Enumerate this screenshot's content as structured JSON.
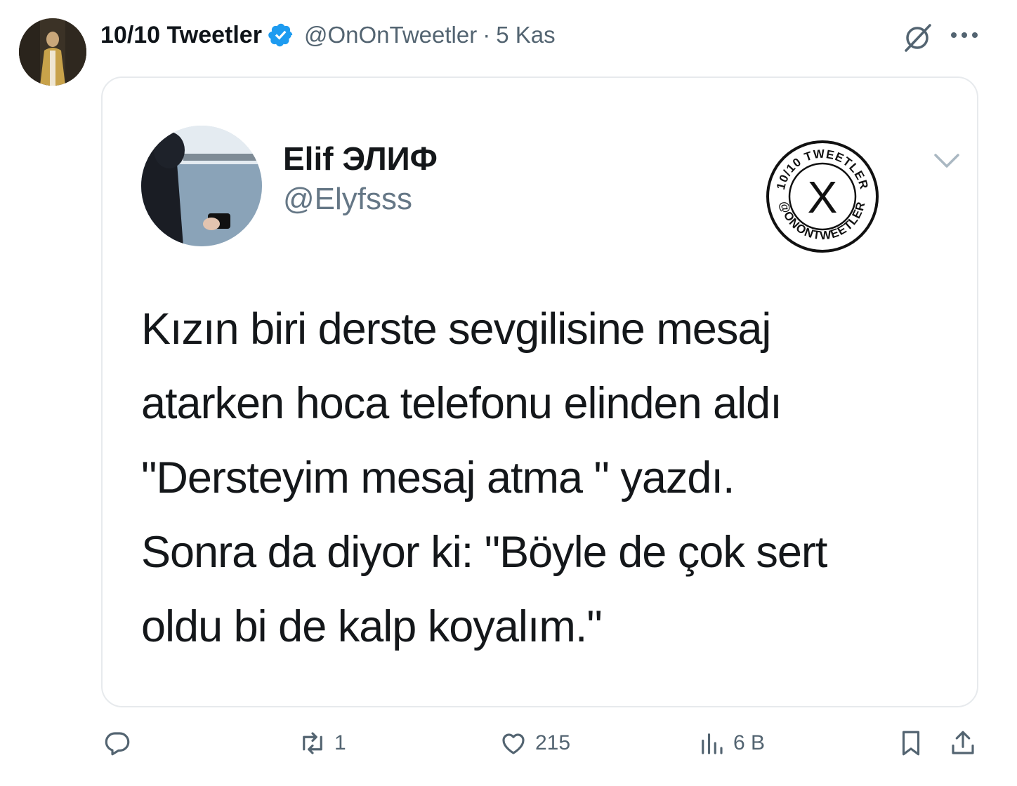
{
  "tweet": {
    "author_name": "10/10 Tweetler",
    "author_handle": "@OnOnTweetler",
    "separator": "·",
    "date": "5 Kas",
    "verified": true,
    "accent_color": "#1d9bf0"
  },
  "quoted_image": {
    "name": "Elif  ЭЛИФ",
    "handle": "@Elyfsss",
    "text": "Kızın biri derste sevgilisine mesaj\natarken hoca telefonu elinden aldı\n\"Dersteyim mesaj atma \" yazdı.\nSonra da diyor ki: \"Böyle de çok sert\noldu bi de kalp koyalım.\"",
    "watermark": {
      "top_text": "10/10 TWEETLER",
      "bottom_text": "@ONONTWEETLER",
      "center": "X"
    }
  },
  "actions": {
    "reply_count": "",
    "retweet_count": "1",
    "like_count": "215",
    "views_count": "6 B"
  },
  "icons": [
    "grok-icon",
    "more-icon",
    "verified-badge-icon",
    "chevron-down-icon",
    "reply-icon",
    "retweet-icon",
    "like-icon",
    "views-icon",
    "bookmark-icon",
    "share-icon"
  ]
}
